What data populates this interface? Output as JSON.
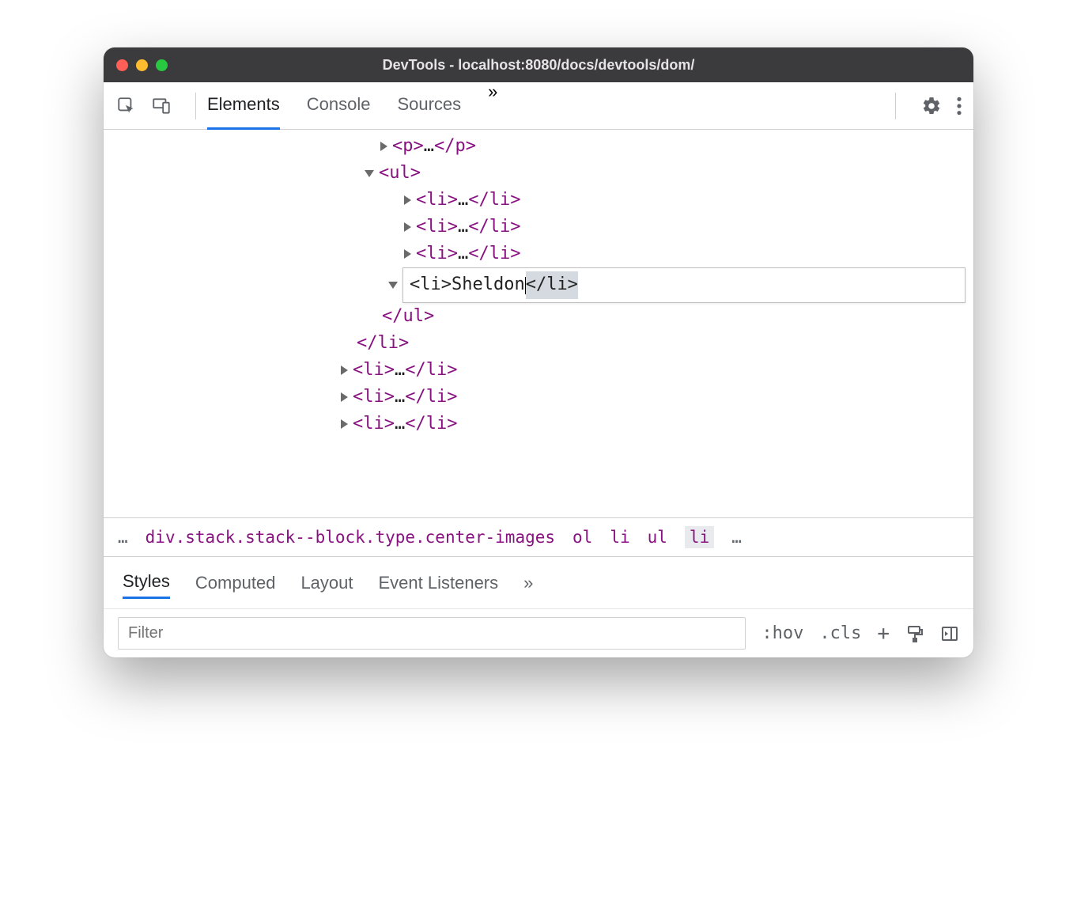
{
  "window": {
    "title": "DevTools - localhost:8080/docs/devtools/dom/"
  },
  "toolbar": {
    "tabs": [
      "Elements",
      "Console",
      "Sources"
    ],
    "active_tab": "Elements",
    "more": "»"
  },
  "dom": {
    "p_open": "<p>",
    "p_ellipsis": "…",
    "p_close": "</p>",
    "ul_open": "<ul>",
    "li_open": "<li>",
    "li_ellipsis": "…",
    "li_close": "</li>",
    "ul_close": "</ul>",
    "edit_value": "<li>Sheldon",
    "edit_close": "</li>",
    "outer_li_close": "</li>"
  },
  "breadcrumb": {
    "leading": "…",
    "path": "div.stack.stack--block.type.center-images",
    "segments": [
      "ol",
      "li",
      "ul",
      "li"
    ],
    "trailing": "…"
  },
  "styles": {
    "tabs": [
      "Styles",
      "Computed",
      "Layout",
      "Event Listeners"
    ],
    "active_tab": "Styles",
    "more": "»"
  },
  "filter": {
    "placeholder": "Filter",
    "hov": ":hov",
    "cls": ".cls",
    "plus": "+"
  }
}
